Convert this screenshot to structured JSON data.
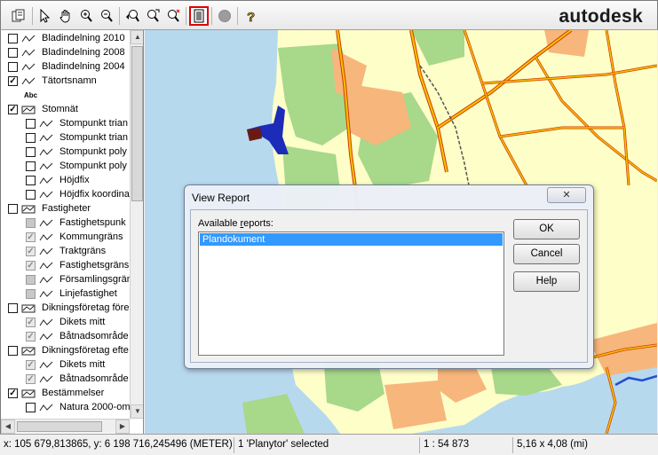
{
  "toolbar": {
    "buttons": [
      {
        "name": "copy-icon"
      },
      {
        "name": "select-arrow-icon"
      },
      {
        "name": "pan-hand-icon"
      },
      {
        "name": "zoom-in-icon"
      },
      {
        "name": "zoom-out-icon"
      },
      {
        "name": "zoom-previous-icon"
      },
      {
        "name": "zoom-selected-icon"
      },
      {
        "name": "zoom-clear-icon"
      },
      {
        "name": "view-report-icon"
      },
      {
        "name": "record-icon"
      },
      {
        "name": "help-icon"
      }
    ],
    "brand": "autodesk"
  },
  "layers": [
    {
      "label": "Bladindelning 2010",
      "checked": false,
      "indent": 0,
      "kind": "line"
    },
    {
      "label": "Bladindelning 2008",
      "checked": false,
      "indent": 0,
      "kind": "line"
    },
    {
      "label": "Bladindelning 2004",
      "checked": false,
      "indent": 0,
      "kind": "line"
    },
    {
      "label": "Tätortsnamn",
      "checked": true,
      "indent": 0,
      "kind": "line"
    },
    {
      "label": "Abc",
      "checked": null,
      "indent": 0,
      "kind": "abc"
    },
    {
      "label": "Stomnät",
      "checked": true,
      "indent": 0,
      "kind": "group"
    },
    {
      "label": "Stompunkt trian",
      "checked": false,
      "indent": 1,
      "kind": "line"
    },
    {
      "label": "Stompunkt trian",
      "checked": false,
      "indent": 1,
      "kind": "line"
    },
    {
      "label": "Stompunkt poly",
      "checked": false,
      "indent": 1,
      "kind": "line"
    },
    {
      "label": "Stompunkt poly",
      "checked": false,
      "indent": 1,
      "kind": "line"
    },
    {
      "label": "Höjdfix",
      "checked": false,
      "indent": 1,
      "kind": "line"
    },
    {
      "label": "Höjdfix koordina",
      "checked": false,
      "indent": 1,
      "kind": "line"
    },
    {
      "label": "Fastigheter",
      "checked": false,
      "indent": 0,
      "kind": "group"
    },
    {
      "label": "Fastighetspunk",
      "checked": "grayfill",
      "indent": 1,
      "kind": "line"
    },
    {
      "label": "Kommungräns",
      "checked": "graycheck",
      "indent": 1,
      "kind": "line"
    },
    {
      "label": "Traktgräns",
      "checked": "graycheck",
      "indent": 1,
      "kind": "line"
    },
    {
      "label": "Fastighetsgräns",
      "checked": "graycheck",
      "indent": 1,
      "kind": "line"
    },
    {
      "label": "Församlingsgrän",
      "checked": "grayfill",
      "indent": 1,
      "kind": "line"
    },
    {
      "label": "Linjefastighet",
      "checked": "grayfill",
      "indent": 1,
      "kind": "line"
    },
    {
      "label": "Dikningsföretag före",
      "checked": false,
      "indent": 0,
      "kind": "group"
    },
    {
      "label": "Dikets mitt",
      "checked": "graycheck",
      "indent": 1,
      "kind": "line"
    },
    {
      "label": "Båtnadsområde",
      "checked": "graycheck",
      "indent": 1,
      "kind": "line"
    },
    {
      "label": "Dikningsföretag efte",
      "checked": false,
      "indent": 0,
      "kind": "group"
    },
    {
      "label": "Dikets mitt",
      "checked": "graycheck",
      "indent": 1,
      "kind": "line"
    },
    {
      "label": "Båtnadsområde",
      "checked": "graycheck",
      "indent": 1,
      "kind": "line"
    },
    {
      "label": "Bestämmelser",
      "checked": true,
      "indent": 0,
      "kind": "group"
    },
    {
      "label": "Natura 2000-om",
      "checked": false,
      "indent": 1,
      "kind": "line"
    }
  ],
  "dialog": {
    "title": "View Report",
    "close": "✕",
    "label_prefix": "Available ",
    "label_underlined": "r",
    "label_suffix": "eports:",
    "reports": [
      "Plandokument"
    ],
    "ok": "OK",
    "cancel": "Cancel",
    "help": "Help"
  },
  "status": {
    "coords": "x: 105 679,813865, y: 6 198 716,245496 (METER)",
    "selection": "1 'Planytor' selected",
    "scale": "1 : 54 873",
    "size": "5,16 x 4,08 (mi)"
  },
  "colors": {
    "water": "#b7d9ee",
    "land": "#fefec8",
    "forest": "#a8d88a",
    "urban": "#f7b67c",
    "road": "#f5c400",
    "road_edge": "#d13b00"
  }
}
